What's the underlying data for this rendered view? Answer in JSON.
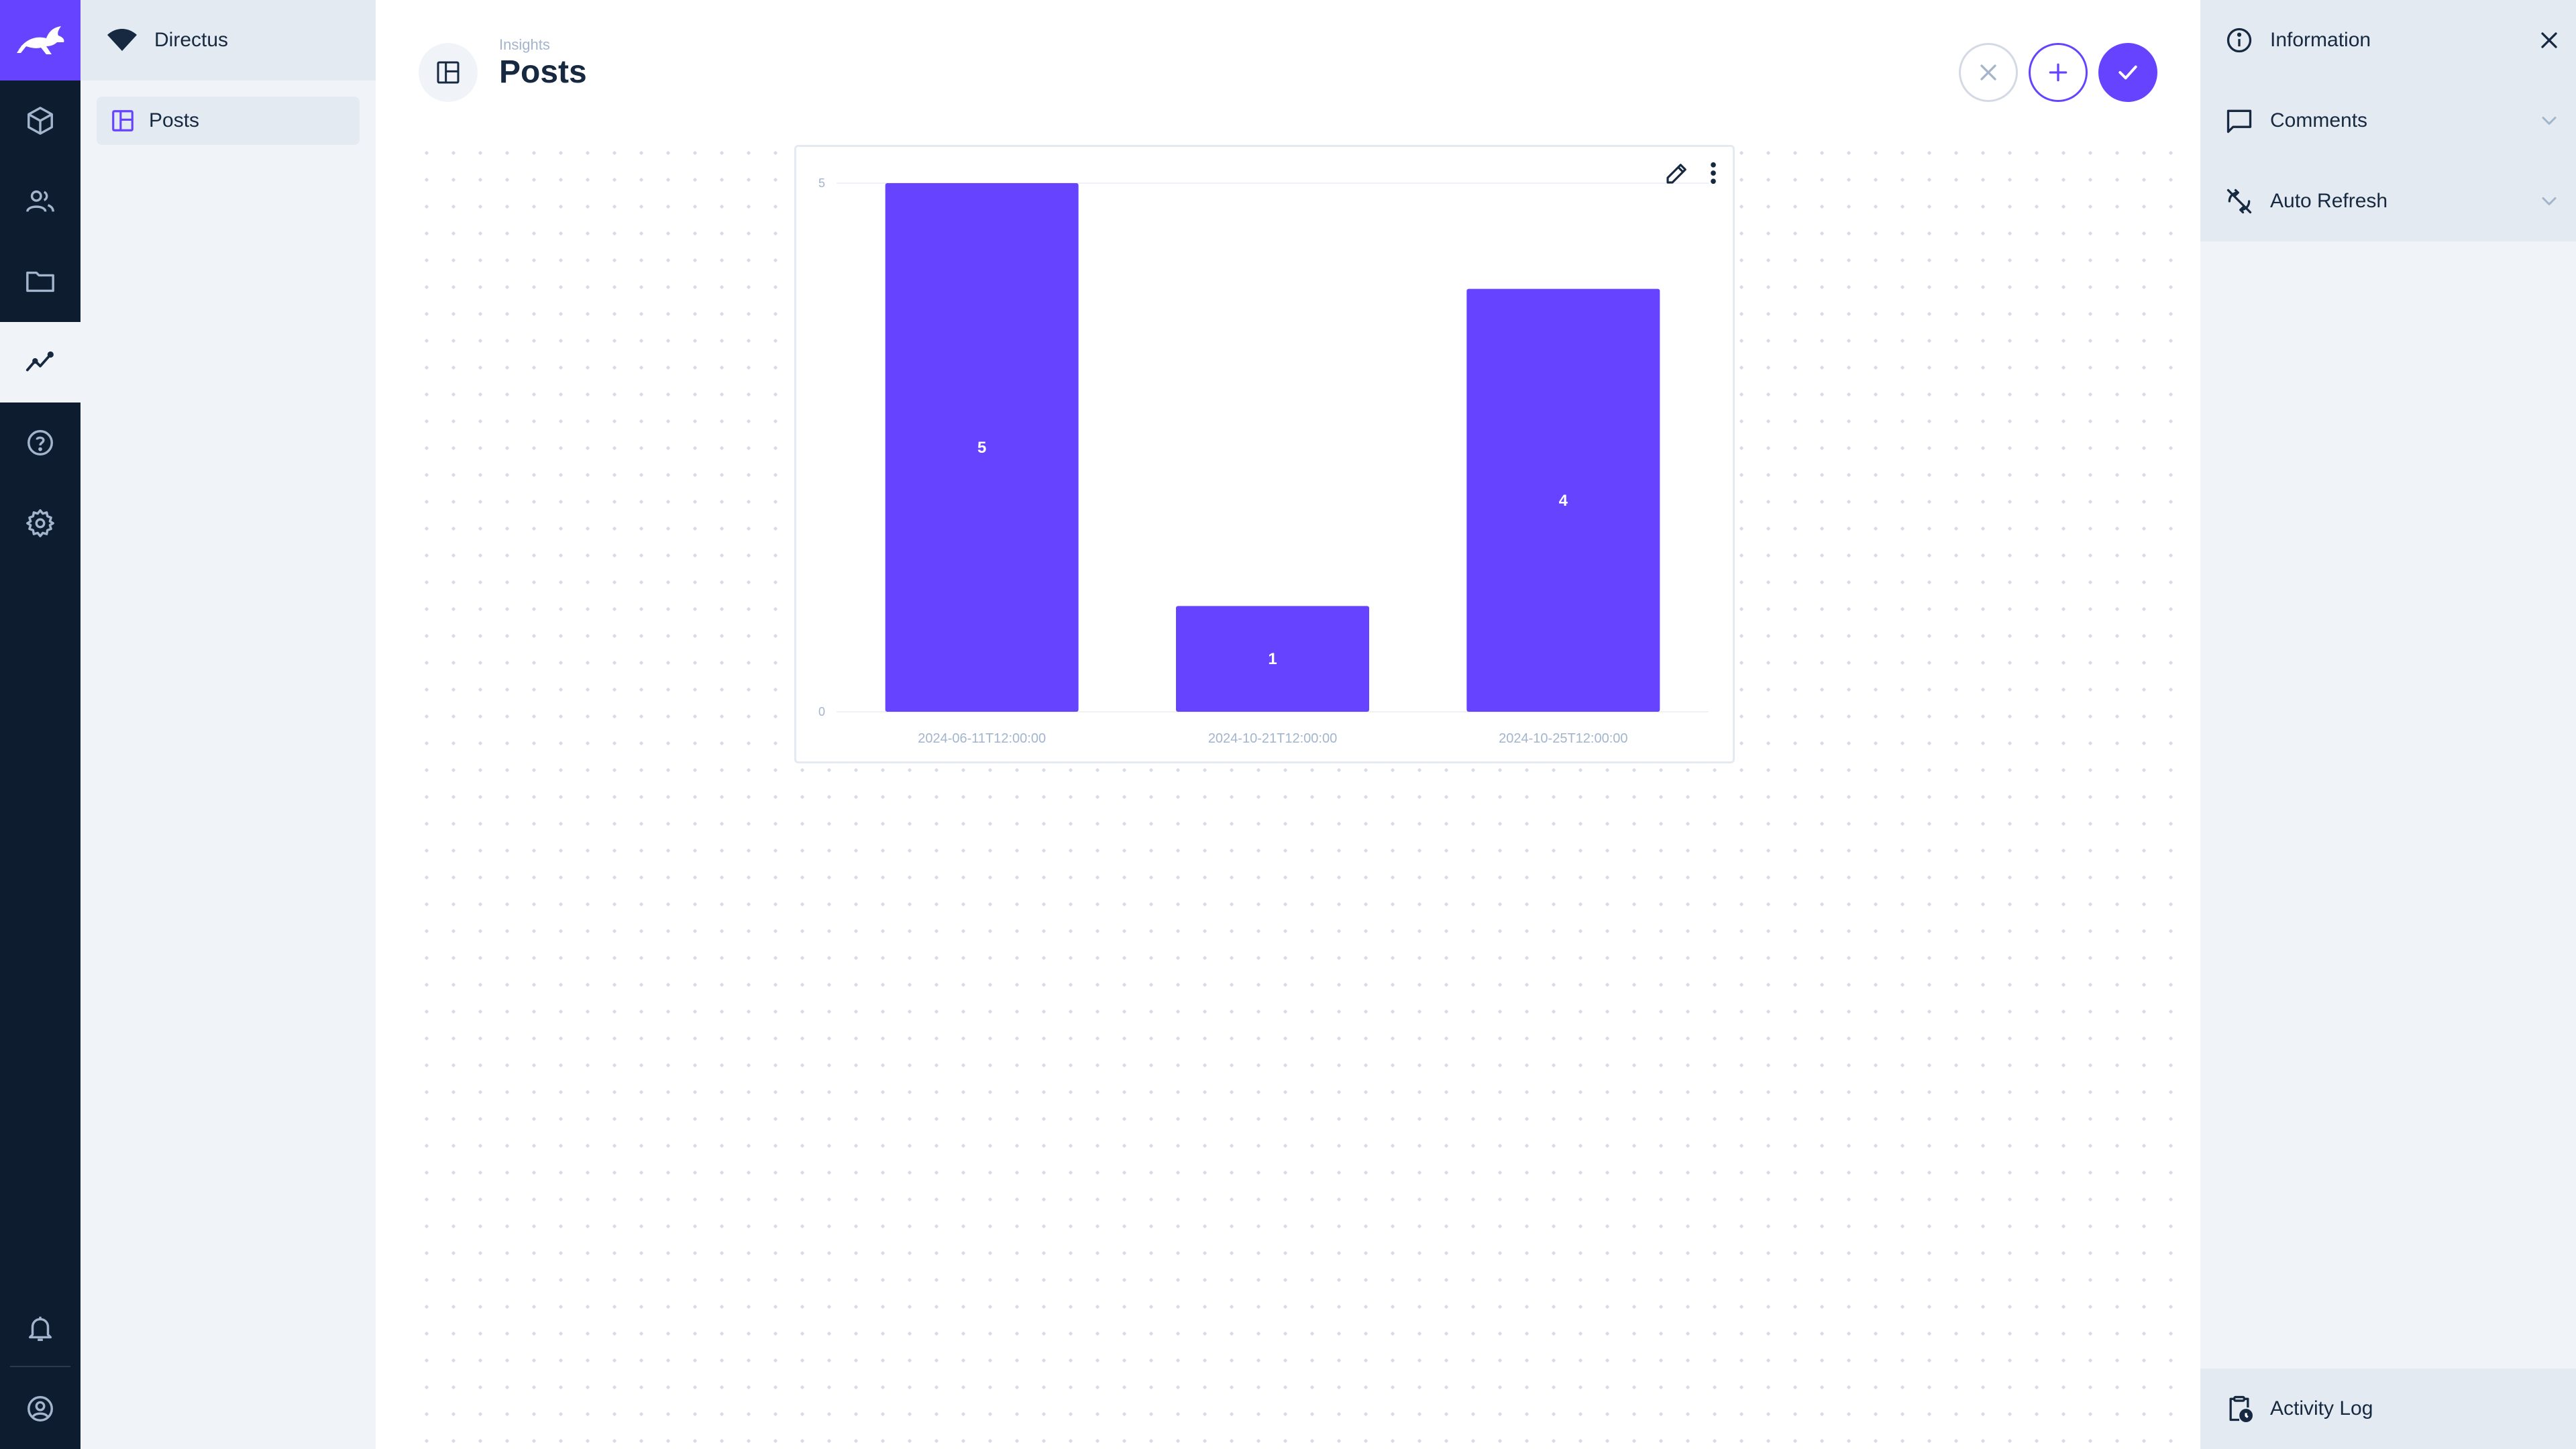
{
  "project": {
    "name": "Directus"
  },
  "modules": [
    {
      "icon": "box-icon"
    },
    {
      "icon": "users-icon"
    },
    {
      "icon": "folder-icon"
    },
    {
      "icon": "insights-icon",
      "active": true
    },
    {
      "icon": "help-icon"
    },
    {
      "icon": "settings-icon"
    }
  ],
  "nav": {
    "items": [
      {
        "label": "Posts",
        "icon": "dashboard-icon"
      }
    ]
  },
  "header": {
    "breadcrumb": "Insights",
    "title": "Posts"
  },
  "sidebar": {
    "items": [
      {
        "label": "Information",
        "icon": "info-icon"
      },
      {
        "label": "Comments",
        "icon": "comment-icon"
      },
      {
        "label": "Auto Refresh",
        "icon": "sync-disabled-icon"
      }
    ],
    "activity_label": "Activity Log"
  },
  "colors": {
    "accent": "#6644ff",
    "module_bar": "#0e1c2f",
    "nav_bg": "#f0f4f9"
  },
  "chart_data": {
    "type": "bar",
    "categories": [
      "2024-06-11T12:00:00",
      "2024-10-21T12:00:00",
      "2024-10-25T12:00:00"
    ],
    "values": [
      5,
      1,
      4
    ],
    "ylim": [
      0,
      5
    ],
    "yticks": [
      0,
      5
    ],
    "title": "",
    "xlabel": "",
    "ylabel": "",
    "data_labels": true,
    "grid": false,
    "bar_color": "#6644ff"
  }
}
